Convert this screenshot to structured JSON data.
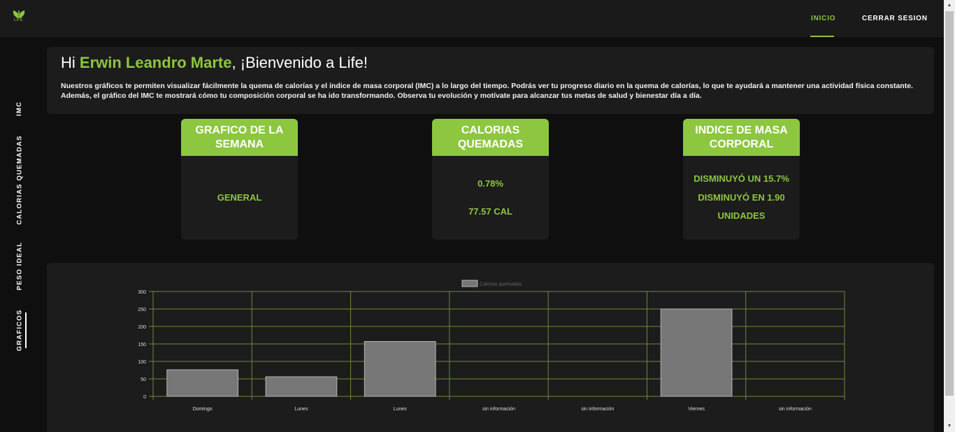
{
  "header": {
    "logo_text": "LIFE",
    "nav": [
      {
        "label": "INICIO",
        "active": true
      },
      {
        "label": "CERRAR SESION",
        "active": false
      }
    ]
  },
  "sidebar": {
    "items": [
      {
        "label": "IMC"
      },
      {
        "label": "CALORIAS QUEMADAS"
      },
      {
        "label": "PESO IDEAL"
      },
      {
        "label": "GRAFICOS",
        "active": true
      }
    ]
  },
  "welcome": {
    "greeting": "Hi ",
    "user_name": "Erwin Leandro Marte",
    "suffix": ", ¡Bienvenido a Life!",
    "description": "Nuestros gráficos te permiten visualizar fácilmente la quema de calorías y el índice de masa corporal (IMC) a lo largo del tiempo. Podrás ver tu progreso diario en la quema de calorías, lo que te ayudará a mantener una actividad física constante. Además, el gráfico del IMC te mostrará cómo tu composición corporal se ha ido transformando. Observa tu evolución y motívate para alcanzar tus metas de salud y bienestar día a día."
  },
  "cards": {
    "week": {
      "title": "GRAFICO DE LA SEMANA",
      "value": "GENERAL"
    },
    "calories": {
      "title": "CALORIAS QUEMADAS",
      "percent": "0.78%",
      "value": "77.57 CAL"
    },
    "bmi": {
      "title": "INDICE DE MASA CORPORAL",
      "line1": "DISMINUYÓ UN 15.7%",
      "line2": "DISMINUYÓ EN 1.90",
      "line3": "UNIDADES"
    }
  },
  "colors": {
    "accent": "#8dc63f",
    "background": "#0f0f0f",
    "card": "#1c1c1c",
    "bar_fill": "#777777",
    "grid": "#6b8a3a"
  },
  "chart_data": {
    "type": "bar",
    "categories": [
      "Domingo",
      "Lunes",
      "Lunes",
      "sin información",
      "sin información",
      "Viernes",
      "sin información"
    ],
    "series": [
      {
        "name": "Calorias quemadas",
        "values": [
          76,
          56,
          157,
          0,
          0,
          250,
          0
        ]
      }
    ],
    "ylim": [
      0,
      300
    ],
    "yticks": [
      0,
      50,
      100,
      150,
      200,
      250,
      300
    ],
    "grid": true,
    "legend": "top-center"
  }
}
